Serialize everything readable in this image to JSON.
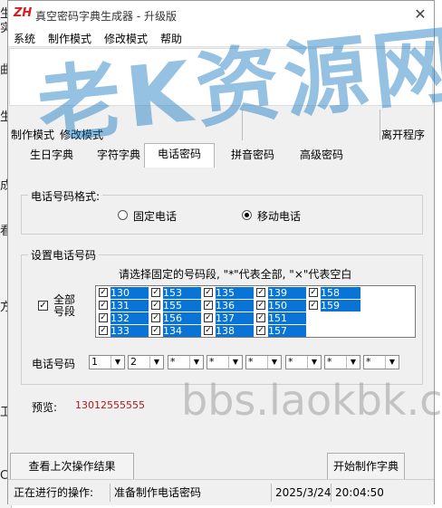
{
  "app": {
    "title": "真空密码字典生成器 - 升级版",
    "icon_text": "ZH",
    "close_icon": "close-icon"
  },
  "background": {
    "chars": [
      "生",
      "实",
      "曲",
      "生",
      "成",
      "看",
      "方",
      "卫",
      "C"
    ]
  },
  "menu": [
    "系统",
    "制作模式",
    "修改模式",
    "帮助"
  ],
  "toolbar": {
    "mode_make": "制作模式",
    "mode_edit": "修改模式",
    "exit": "离开程序"
  },
  "tabs": [
    "生日字典",
    "字符字典",
    "电话密码",
    "拼音密码",
    "高级密码"
  ],
  "active_tab": "电话密码",
  "phone_format": {
    "legend": "电话号码格式:",
    "options": [
      "固定电话",
      "移动电话"
    ],
    "selected": "移动电话"
  },
  "set_number": {
    "legend": "设置电话号码",
    "hint": "请选择固定的号码段, \"*\"代表全部, \"×\"代表空白",
    "select_all_label": "全部号段",
    "prefixes": [
      [
        "130",
        "153",
        "135",
        "139",
        "158"
      ],
      [
        "131",
        "155",
        "136",
        "150",
        "159"
      ],
      [
        "132",
        "156",
        "137",
        "151"
      ],
      [
        "133",
        "134",
        "138",
        "157"
      ]
    ],
    "number_label": "电话号码",
    "digits": [
      "1",
      "2",
      "*",
      "*",
      "*",
      "*",
      "*",
      "*"
    ]
  },
  "preview": {
    "label": "预览:",
    "value": "13012555555",
    "color": "#b01818"
  },
  "buttons": {
    "last_result": "查看上次操作结果",
    "start": "开始制作字典"
  },
  "status": {
    "label": "正在进行的操作:",
    "message": "准备制作电话密码",
    "date": "2025/3/24",
    "time": "20:04:50"
  },
  "watermark": {
    "main": "老K资源网",
    "site": "bbs.laokbk.cn"
  },
  "colors": {
    "selection": "#0a74d6",
    "watermark": "#1478be"
  }
}
